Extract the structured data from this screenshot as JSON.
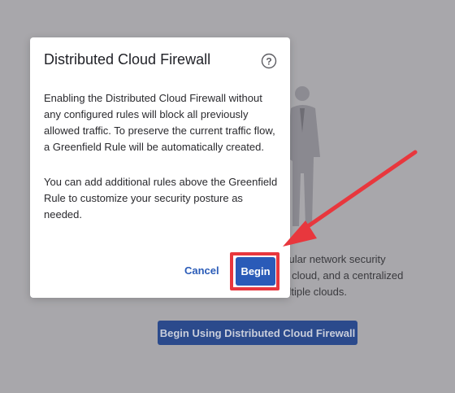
{
  "background": {
    "description_lines": [
      "anular network security",
      "he cloud, and a centralized",
      "nultiple clouds."
    ],
    "cta_label": "Begin Using Distributed Cloud Firewall",
    "illustration_icon": "person-illustration-icon"
  },
  "dialog": {
    "title": "Distributed Cloud Firewall",
    "help_icon": "help-circle-icon",
    "paragraphs": [
      "Enabling the Distributed Cloud Firewall without any configured rules will block all previously allowed traffic. To preserve the current traffic flow, a Greenfield Rule will be automatically created.",
      "You can add additional rules above the Greenfield Rule to customize your security posture as needed."
    ],
    "cancel_label": "Cancel",
    "begin_label": "Begin"
  },
  "annotation": {
    "color": "#e8373d",
    "arrow_icon": "arrow-pointer-icon"
  },
  "colors": {
    "accent": "#2a5bb8",
    "overlay_bg": "#a8a7ab"
  }
}
